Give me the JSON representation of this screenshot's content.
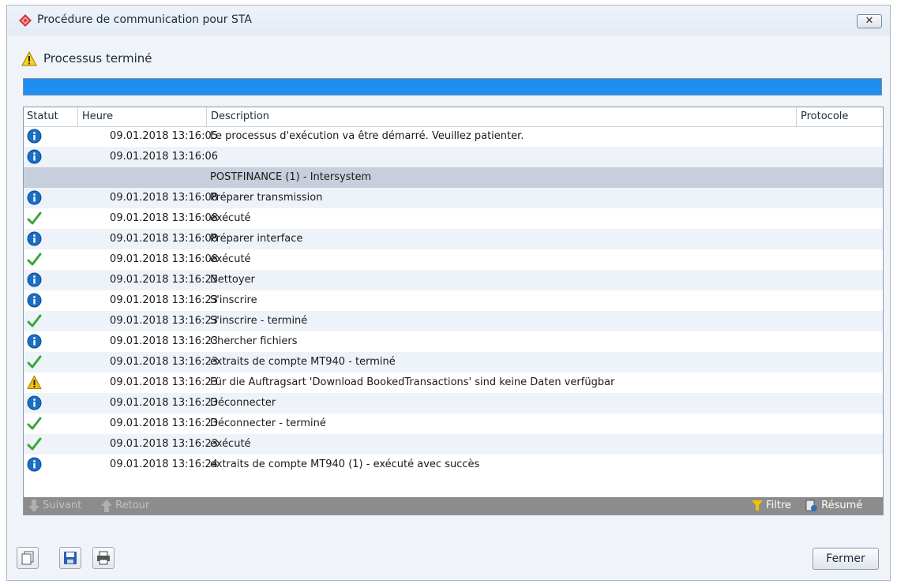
{
  "window": {
    "title": "Procédure de communication pour STA",
    "close_glyph": "✕"
  },
  "status": {
    "text": "Processus terminé",
    "icon": "warning-icon",
    "progress_percent": 100,
    "progress_color": "#1e8ff0"
  },
  "table": {
    "columns": [
      "Statut",
      "Heure",
      "Description",
      "Protocole"
    ],
    "rows": [
      {
        "status": "info",
        "time": "09.01.2018 13:16:05",
        "description": "Le processus d'exécution va être démarré. Veuillez patienter."
      },
      {
        "status": "info",
        "time": "09.01.2018 13:16:06",
        "description": ""
      },
      {
        "status": "group",
        "time": "",
        "description": "POSTFINANCE (1) - Intersystem"
      },
      {
        "status": "info",
        "time": "09.01.2018 13:16:08",
        "description": "Préparer transmission"
      },
      {
        "status": "check",
        "time": "09.01.2018 13:16:08",
        "description": "exécuté"
      },
      {
        "status": "info",
        "time": "09.01.2018 13:16:08",
        "description": "Préparer interface"
      },
      {
        "status": "check",
        "time": "09.01.2018 13:16:08",
        "description": "exécuté"
      },
      {
        "status": "info",
        "time": "09.01.2018 13:16:23",
        "description": "Nettoyer"
      },
      {
        "status": "info",
        "time": "09.01.2018 13:16:23",
        "description": "S'inscrire"
      },
      {
        "status": "check",
        "time": "09.01.2018 13:16:23",
        "description": "S'inscrire - terminé"
      },
      {
        "status": "info",
        "time": "09.01.2018 13:16:23",
        "description": "Chercher fichiers"
      },
      {
        "status": "check",
        "time": "09.01.2018 13:16:23",
        "description": "extraits de compte MT940 - terminé"
      },
      {
        "status": "warning",
        "time": "09.01.2018 13:16:23",
        "description": "Für die Auftragsart 'Download BookedTransactions' sind keine Daten verfügbar"
      },
      {
        "status": "info",
        "time": "09.01.2018 13:16:23",
        "description": "Déconnecter"
      },
      {
        "status": "check",
        "time": "09.01.2018 13:16:23",
        "description": "Déconnecter - terminé"
      },
      {
        "status": "check",
        "time": "09.01.2018 13:16:23",
        "description": "exécuté"
      },
      {
        "status": "info",
        "time": "09.01.2018 13:16:24",
        "description": "extraits de compte MT940 (1) - exécuté avec succès"
      }
    ]
  },
  "footer": {
    "next_label": "Suivant",
    "back_label": "Retour",
    "filter_label": "Filtre",
    "summary_label": "Résumé"
  },
  "toolbar": {
    "copy_icon": "copy-icon",
    "save_icon": "save-icon",
    "print_icon": "print-icon"
  },
  "buttons": {
    "close_label": "Fermer"
  },
  "colors": {
    "info": "#1a6fc4",
    "check": "#3aa53a",
    "warning": "#f2c200",
    "group_row": "#c7cfdd"
  }
}
